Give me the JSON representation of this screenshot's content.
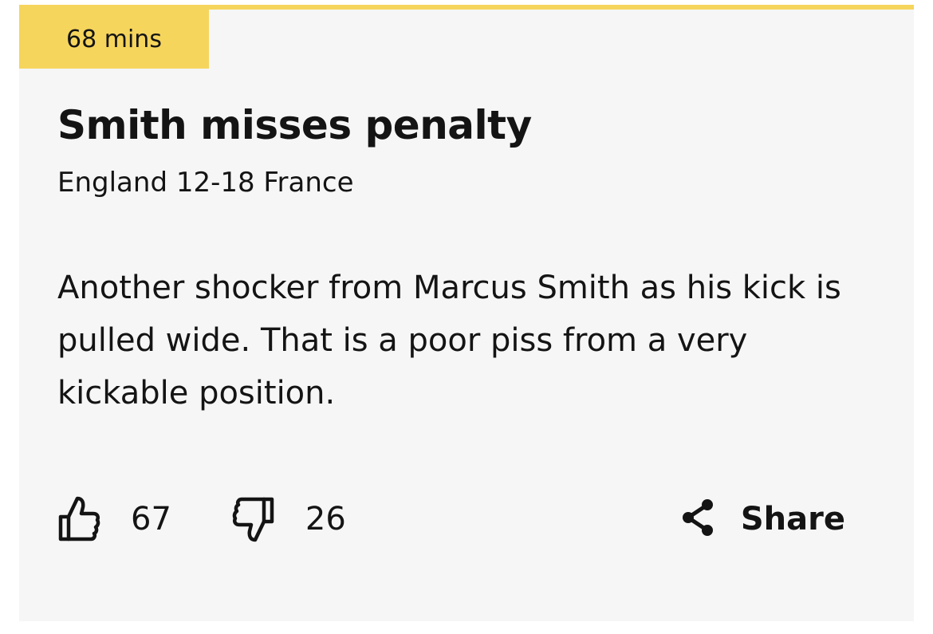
{
  "post": {
    "time": "68 mins",
    "title": "Smith misses penalty",
    "score": "England 12-18 France",
    "body": "Another shocker from Marcus Smith as his kick is pulled wide. That is a poor piss from a very kickable position."
  },
  "reactions": {
    "likes": "67",
    "dislikes": "26",
    "like_icon": "thumbs-up-icon",
    "dislike_icon": "thumbs-down-icon"
  },
  "share": {
    "label": "Share",
    "icon": "share-icon"
  },
  "colors": {
    "accent": "#f6d55c",
    "card_background": "#f6f6f6",
    "text": "#141414"
  }
}
